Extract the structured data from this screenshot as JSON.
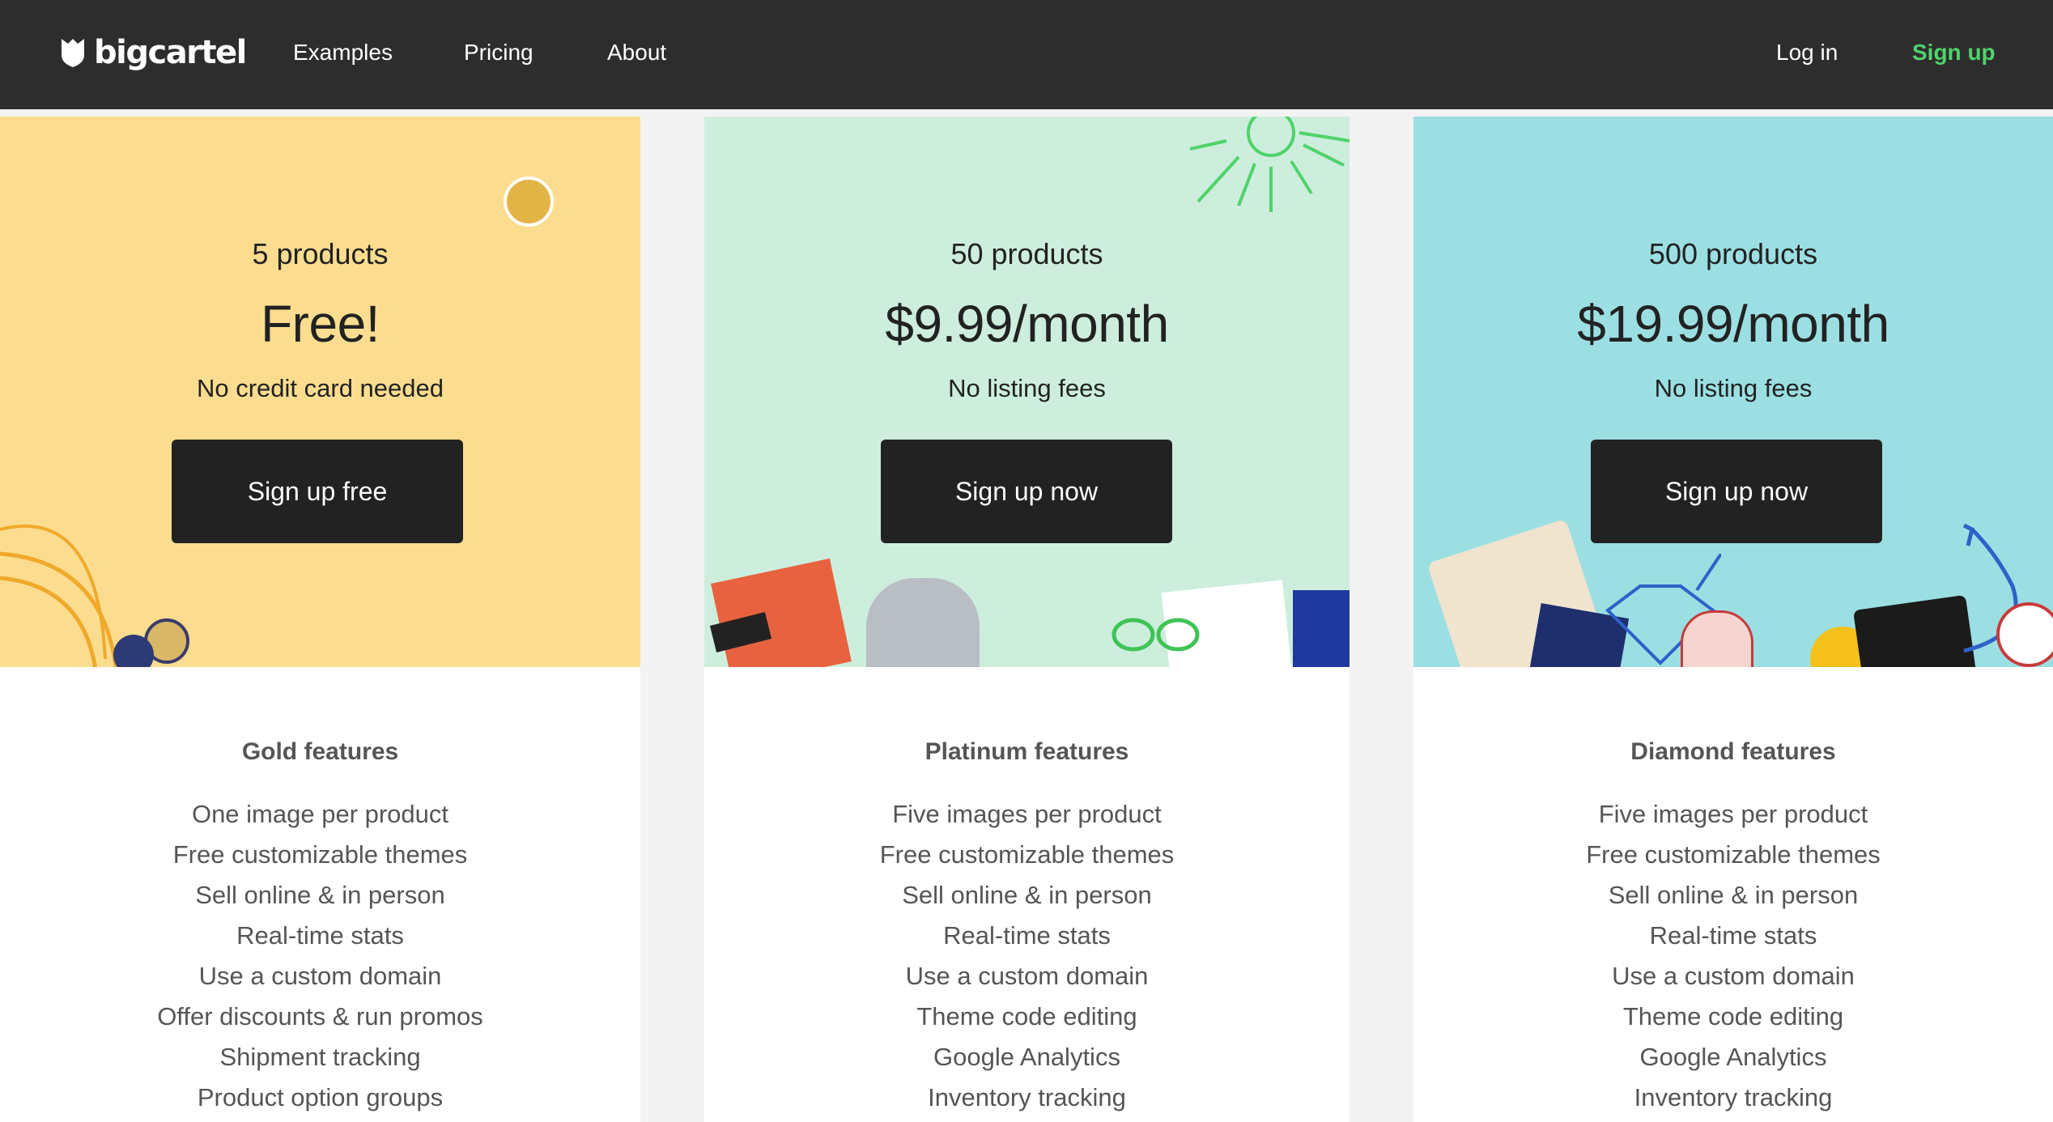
{
  "nav": {
    "logo_text": "bigcartel",
    "links": [
      "Examples",
      "Pricing",
      "About"
    ],
    "login": "Log in",
    "signup": "Sign up"
  },
  "plans": [
    {
      "products": "5 products",
      "price": "Free!",
      "note": "No credit card needed",
      "cta": "Sign up free",
      "color": "#fcdd8f",
      "features_title": "Gold features",
      "features": [
        "One image per product",
        "Free customizable themes",
        "Sell online & in person",
        "Real-time stats",
        "Use a custom domain",
        "Offer discounts & run promos",
        "Shipment tracking",
        "Product option groups"
      ]
    },
    {
      "products": "50 products",
      "price": "$9.99/month",
      "note": "No listing fees",
      "cta": "Sign up now",
      "color": "#cdeedd",
      "features_title": "Platinum features",
      "features": [
        "Five images per product",
        "Free customizable themes",
        "Sell online & in person",
        "Real-time stats",
        "Use a custom domain",
        "Theme code editing",
        "Google Analytics",
        "Inventory tracking"
      ]
    },
    {
      "products": "500 products",
      "price": "$19.99/month",
      "note": "No listing fees",
      "cta": "Sign up now",
      "color": "#9bdfe3",
      "features_title": "Diamond features",
      "features": [
        "Five images per product",
        "Free customizable themes",
        "Sell online & in person",
        "Real-time stats",
        "Use a custom domain",
        "Theme code editing",
        "Google Analytics",
        "Inventory tracking"
      ]
    }
  ],
  "colors": {
    "nav_bg": "#2d2d2d",
    "accent_green": "#4fd36a",
    "button_bg": "#222222"
  }
}
